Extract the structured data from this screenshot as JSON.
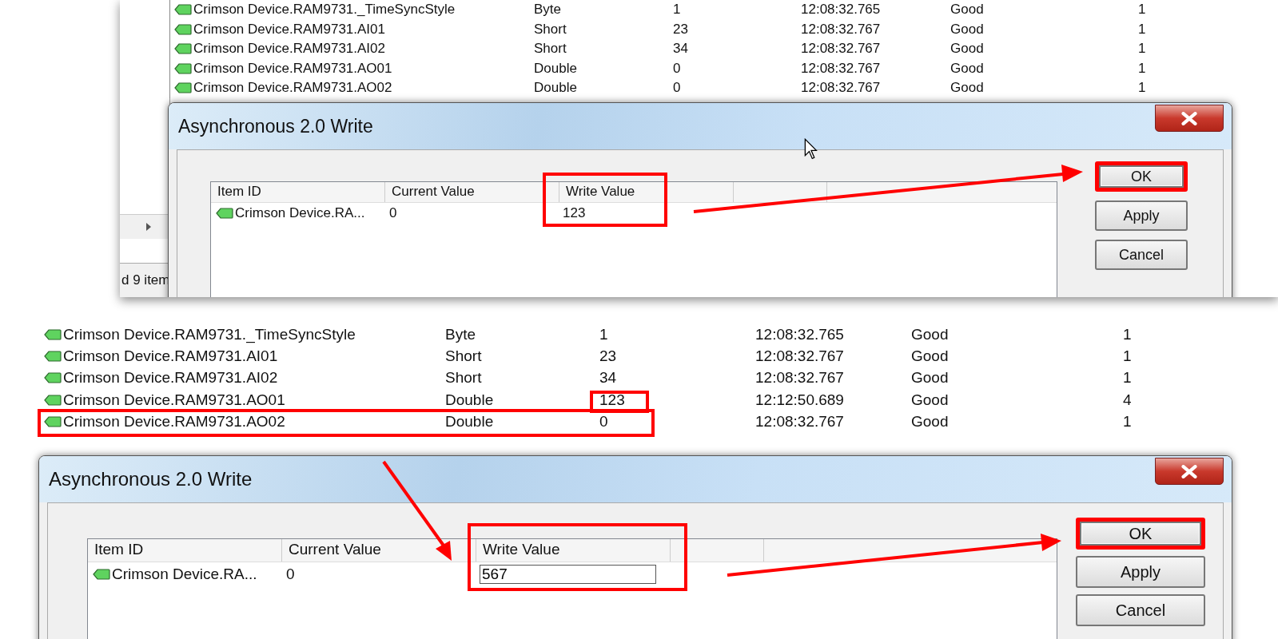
{
  "panels": [
    {
      "rows": [
        {
          "name": "Crimson Device.RAM9731._TimeSyncStyle",
          "type": "Byte",
          "value": "1",
          "timestamp": "12:08:32.765",
          "quality": "Good",
          "update_count": "1",
          "highlighted": false,
          "value_highlighted": false
        },
        {
          "name": "Crimson Device.RAM9731.AI01",
          "type": "Short",
          "value": "23",
          "timestamp": "12:08:32.767",
          "quality": "Good",
          "update_count": "1",
          "highlighted": false,
          "value_highlighted": false
        },
        {
          "name": "Crimson Device.RAM9731.AI02",
          "type": "Short",
          "value": "34",
          "timestamp": "12:08:32.767",
          "quality": "Good",
          "update_count": "1",
          "highlighted": false,
          "value_highlighted": false
        },
        {
          "name": "Crimson Device.RAM9731.AO01",
          "type": "Double",
          "value": "0",
          "timestamp": "12:08:32.767",
          "quality": "Good",
          "update_count": "1",
          "highlighted": false,
          "value_highlighted": false
        },
        {
          "name": "Crimson Device.RAM9731.AO02",
          "type": "Double",
          "value": "0",
          "timestamp": "12:08:32.767",
          "quality": "Good",
          "update_count": "1",
          "highlighted": false,
          "value_highlighted": false
        }
      ],
      "status_text": "d 9 item",
      "dialog": {
        "title": "Asynchronous 2.0 Write",
        "columns": [
          "Item ID",
          "Current Value",
          "Write Value"
        ],
        "item": {
          "id": "Crimson Device.RA...",
          "current_value": "0",
          "write_value": "123",
          "in_edit": false
        },
        "write_value_highlighted": true,
        "buttons": [
          {
            "label": "OK",
            "highlighted": true
          },
          {
            "label": "Apply",
            "highlighted": false
          },
          {
            "label": "Cancel",
            "highlighted": false
          }
        ]
      }
    },
    {
      "rows": [
        {
          "name": "Crimson Device.RAM9731._TimeSyncStyle",
          "type": "Byte",
          "value": "1",
          "timestamp": "12:08:32.765",
          "quality": "Good",
          "update_count": "1",
          "highlighted": false,
          "value_highlighted": false
        },
        {
          "name": "Crimson Device.RAM9731.AI01",
          "type": "Short",
          "value": "23",
          "timestamp": "12:08:32.767",
          "quality": "Good",
          "update_count": "1",
          "highlighted": false,
          "value_highlighted": false
        },
        {
          "name": "Crimson Device.RAM9731.AI02",
          "type": "Short",
          "value": "34",
          "timestamp": "12:08:32.767",
          "quality": "Good",
          "update_count": "1",
          "highlighted": false,
          "value_highlighted": false
        },
        {
          "name": "Crimson Device.RAM9731.AO01",
          "type": "Double",
          "value": "123",
          "timestamp": "12:12:50.689",
          "quality": "Good",
          "update_count": "4",
          "highlighted": false,
          "value_highlighted": true
        },
        {
          "name": "Crimson Device.RAM9731.AO02",
          "type": "Double",
          "value": "0",
          "timestamp": "12:08:32.767",
          "quality": "Good",
          "update_count": "1",
          "highlighted": true,
          "value_highlighted": false
        }
      ],
      "dialog": {
        "title": "Asynchronous 2.0 Write",
        "columns": [
          "Item ID",
          "Current Value",
          "Write Value"
        ],
        "item": {
          "id": "Crimson Device.RA...",
          "current_value": "0",
          "write_value": "567",
          "in_edit": true
        },
        "write_value_highlighted": true,
        "buttons": [
          {
            "label": "OK",
            "highlighted": true
          },
          {
            "label": "Apply",
            "highlighted": false
          },
          {
            "label": "Cancel",
            "highlighted": false
          }
        ]
      }
    }
  ]
}
